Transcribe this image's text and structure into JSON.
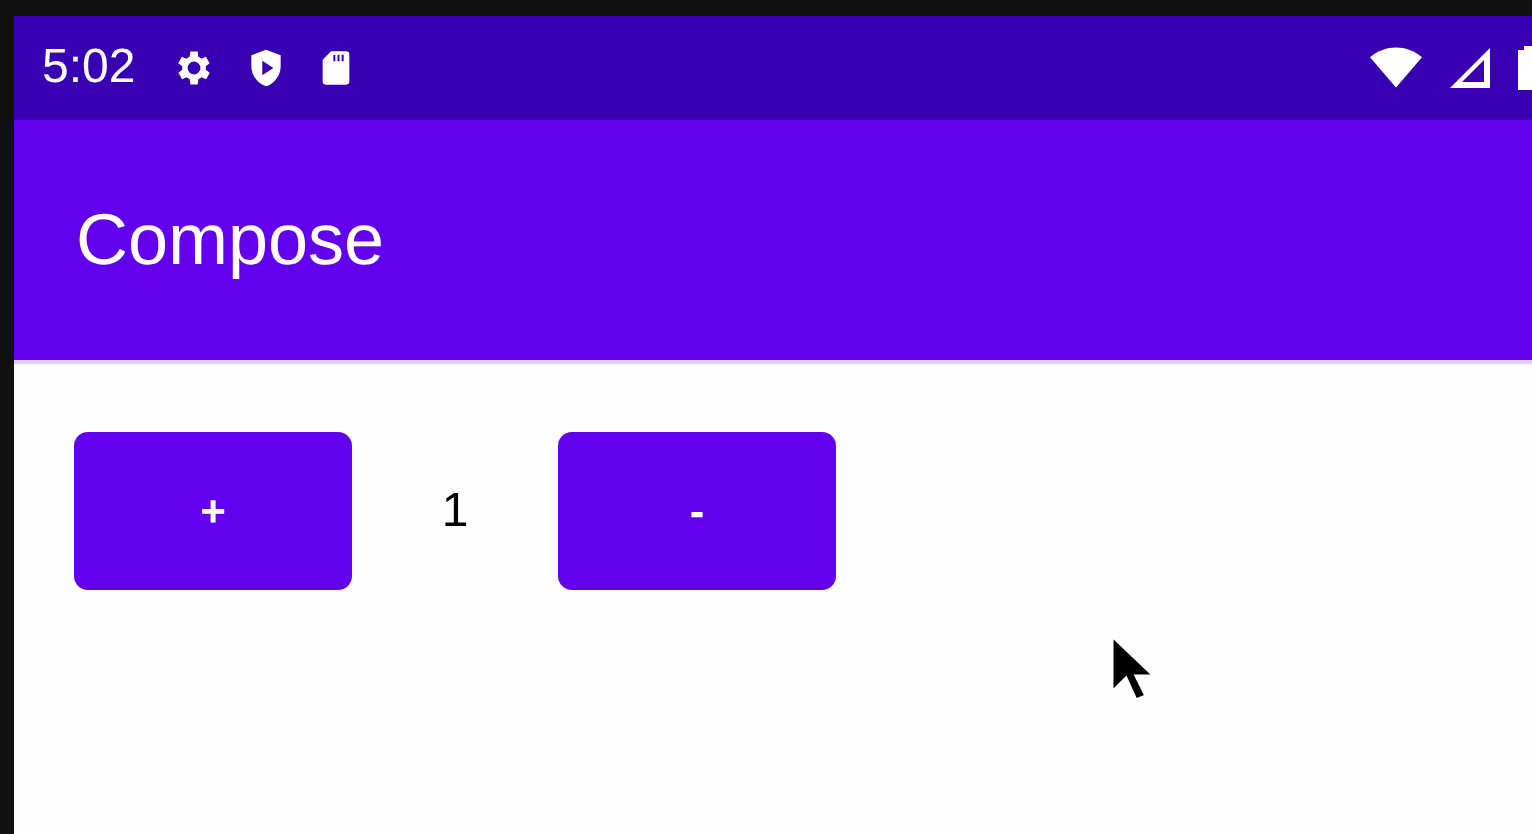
{
  "status_bar": {
    "time": "5:02"
  },
  "app_bar": {
    "title": "Compose"
  },
  "counter": {
    "increment_label": "+",
    "value": "1",
    "decrement_label": "-"
  }
}
